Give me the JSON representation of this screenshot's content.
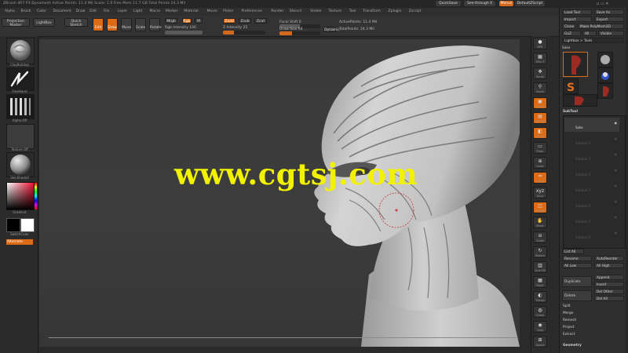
{
  "titlebar": {
    "title": "ZBrush 4R7 P3   Dynamesh   Active Points: 11.4 Mil   Scale: 1.0   Free Mem 11.7 GB   Total Points 24.3 Mil",
    "quicksave": "QuickSave",
    "see_through": "See-through 0",
    "menus_label": "Menus",
    "default_zscript": "DefaultZScript"
  },
  "menubar": {
    "items": [
      "Alpha",
      "Brush",
      "Color",
      "Document",
      "Draw",
      "Edit",
      "File",
      "Layer",
      "Light",
      "Macro",
      "Marker",
      "Material",
      "Movie",
      "Picker",
      "Preferences",
      "Render",
      "Stencil",
      "Stroke",
      "Texture",
      "Tool",
      "Transform",
      "Zplugin",
      "Zscript"
    ]
  },
  "toolbar": {
    "projection_master": "Projection Master",
    "lightbox": "LightBox",
    "quick_sketch": "Quick Sketch",
    "edit": "Edit",
    "draw": "Draw",
    "move": "Move",
    "scale": "Scale",
    "rotate": "Rotate",
    "mrgb": "Mrgb",
    "rgb": "Rgb",
    "m": "M",
    "zadd": "Zadd",
    "zsub": "Zsub",
    "zcut": "Zcut",
    "rgb_intensity": "Rgb Intensity 100",
    "z_intensity": "Z Intensity 25",
    "focal_shift": "Focal Shift 0",
    "draw_size": "Draw Size 64",
    "dynamic": "Dynamic",
    "active_points": "ActivePoints: 11.4 Mil",
    "total_points": "TotalPoints: 24.3 Mil",
    "rgb_intensity_value": 1.0,
    "z_intensity_value": 0.25,
    "focal_shift_value": 0.5,
    "draw_size_value": 0.3
  },
  "leftshelf": {
    "brush_label": "ClayBuildup",
    "stroke_label": "FreeHand",
    "alpha_label": "Alpha Off",
    "texture_label": "Texture Off",
    "material_label": "SkinShade4",
    "gradient_label": "Gradient",
    "switch_color_label": "SwitchColor",
    "alternate_label": "Alternate"
  },
  "rightshelf": {
    "buttons": [
      {
        "name": "bpr",
        "glyph": "●",
        "label": "BPR"
      },
      {
        "name": "spix",
        "glyph": "▦",
        "label": "SPix 3"
      },
      {
        "name": "scroll",
        "glyph": "✥",
        "label": "Scroll"
      },
      {
        "name": "zoom",
        "glyph": "⚲",
        "label": "Zoom"
      },
      {
        "name": "actual",
        "glyph": "▣",
        "label": "Actual"
      },
      {
        "name": "aahalf",
        "glyph": "▤",
        "label": "AAHalf"
      },
      {
        "name": "persp",
        "glyph": "◧",
        "label": "Persp"
      },
      {
        "name": "floor",
        "glyph": "▭",
        "label": "Floor"
      },
      {
        "name": "local",
        "glyph": "⊕",
        "label": "Local"
      },
      {
        "name": "lsym",
        "glyph": "⇔",
        "label": "L.Sym"
      },
      {
        "name": "xyz",
        "glyph": "xyz",
        "label": "Gxyz"
      },
      {
        "name": "frame",
        "glyph": "◫",
        "label": "Frame"
      },
      {
        "name": "move",
        "glyph": "✋",
        "label": "Move"
      },
      {
        "name": "zoom3d",
        "glyph": "⊖",
        "label": "Scale"
      },
      {
        "name": "rotate",
        "glyph": "↻",
        "label": "Rotate"
      },
      {
        "name": "linefill",
        "glyph": "▥",
        "label": "Line Fill"
      },
      {
        "name": "polyf",
        "glyph": "▦",
        "label": "PolyF"
      },
      {
        "name": "transp",
        "glyph": "◐",
        "label": "Transp"
      },
      {
        "name": "ghost",
        "glyph": "◍",
        "label": "Ghost"
      },
      {
        "name": "solo",
        "glyph": "◉",
        "label": "Solo"
      },
      {
        "name": "xpose",
        "glyph": "⊞",
        "label": "Xpose"
      }
    ]
  },
  "palette": {
    "load_tool": "Load Tool",
    "save_as": "Save As",
    "import": "Import",
    "export": "Export",
    "clone": "Clone",
    "make_polymesh": "Make PolyMesh3D",
    "goz": "GoZ",
    "all": "All",
    "visible": "Visible",
    "lightbox_tools": "Lightbox > Tools",
    "current_tool": "Sake",
    "tool_names": [
      "Sake",
      "SphereBrush",
      "SimpleBrush",
      "Sake"
    ],
    "subtool_header": "SubTool",
    "subtools": [
      "Sake",
      "Subtool 2",
      "Subtool 3",
      "Subtool 4",
      "Subtool 5",
      "Subtool 6",
      "Subtool 7",
      "Subtool 8"
    ],
    "list_all": "List All",
    "rename": "Rename",
    "autoreorder": "AutoReorder",
    "all_low": "All Low",
    "all_high": "All High",
    "duplicate": "Duplicate",
    "append": "Append",
    "insert": "Insert",
    "delete": "Delete",
    "del_other": "Del Other",
    "del_all": "Del All",
    "split": "Split",
    "merge": "Merge",
    "remesh": "Remesh",
    "project": "Project",
    "extract": "Extract",
    "geometry": "Geometry"
  },
  "watermark": {
    "text": "www.cgtsj.com"
  },
  "colors": {
    "accent": "#dd6a14",
    "watermark": "#f2f200"
  }
}
